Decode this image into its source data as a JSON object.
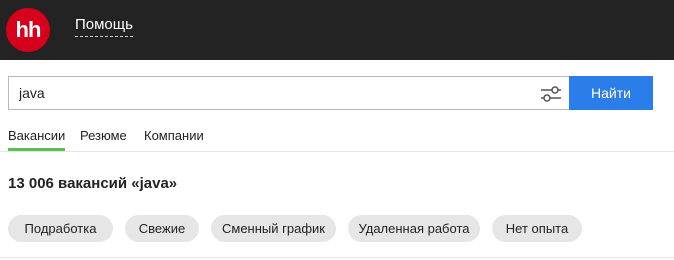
{
  "header": {
    "logo_text": "hh",
    "help_link": "Помощь"
  },
  "search": {
    "query": "java",
    "button_label": "Найти"
  },
  "tabs": [
    {
      "label": "Вакансии",
      "active": true
    },
    {
      "label": "Резюме",
      "active": false
    },
    {
      "label": "Компании",
      "active": false
    }
  ],
  "results": {
    "title": "13 006 вакансий «java»"
  },
  "filters": [
    {
      "label": "Подработка"
    },
    {
      "label": "Свежие"
    },
    {
      "label": "Сменный график"
    },
    {
      "label": "Удаленная работа"
    },
    {
      "label": "Нет опыта"
    }
  ],
  "colors": {
    "header_bg": "#232323",
    "logo_bg": "#d6001c",
    "search_button_bg": "#2b7de9",
    "active_tab_underline": "#5bbf53",
    "chip_bg": "#e6e6e6"
  }
}
